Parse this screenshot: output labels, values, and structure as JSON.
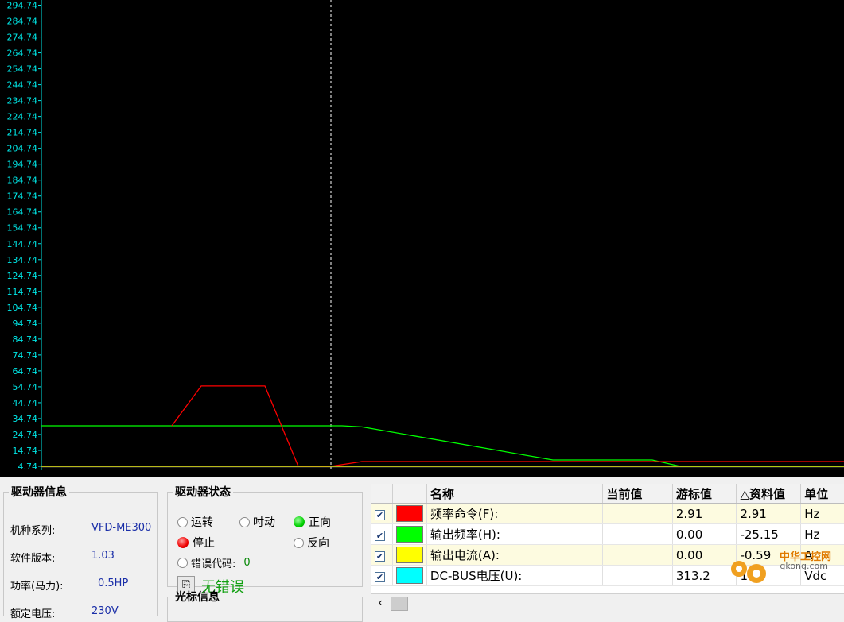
{
  "chart_data": {
    "type": "line",
    "y_ticks": [
      "4.74",
      "14.74",
      "24.74",
      "34.74",
      "44.74",
      "54.74",
      "64.74",
      "74.74",
      "84.74",
      "94.74",
      "104.74",
      "114.74",
      "124.74",
      "134.74",
      "144.74",
      "154.74",
      "164.74",
      "174.74",
      "184.74",
      "194.74",
      "204.74",
      "214.74",
      "224.74",
      "234.74",
      "244.74",
      "254.74",
      "264.74",
      "274.74",
      "284.74",
      "294.74"
    ],
    "ylim": [
      0,
      297
    ],
    "background": "#000000",
    "axis_color": "#00e5e5",
    "cursor_x": 416,
    "series": [
      {
        "color": "#ff0000",
        "x": [
          216,
          253,
          333,
          375,
          416,
          455,
          1061
        ],
        "y": [
          25.5,
          50.5,
          50.5,
          0,
          0,
          3,
          3
        ]
      },
      {
        "color": "#00ff00",
        "x": [
          52,
          430,
          455,
          695,
          820,
          855,
          1061
        ],
        "y": [
          25.5,
          25.5,
          24.8,
          4.0,
          4.0,
          0,
          0
        ]
      },
      {
        "color": "#ffff00",
        "x": [
          52,
          1061
        ],
        "y": [
          0,
          0
        ]
      }
    ]
  },
  "drive_info": {
    "title": "驱动器信息",
    "rows": [
      {
        "label": "机种系列:",
        "value": "VFD-ME300"
      },
      {
        "label": "软件版本:",
        "value": "1.03"
      },
      {
        "label": "功率(马力):",
        "value": "0.5HP"
      },
      {
        "label": "额定电压:",
        "value": "230V"
      }
    ]
  },
  "drive_status": {
    "title": "驱动器状态",
    "run": "运转",
    "jog": "吋动",
    "forward": "正向",
    "stop": "停止",
    "reverse": "反向",
    "error_code_label": "错误代码:",
    "error_code_value": "0",
    "no_error": "无错误",
    "forward_led_color": "#00d000",
    "stop_led_color": "#f00000"
  },
  "cursor_info": {
    "title": "光标信息"
  },
  "table": {
    "headers": [
      "",
      "",
      "名称",
      "当前值",
      "游标值",
      "△资料值",
      "单位"
    ],
    "rows": [
      {
        "color": "#ff0000",
        "name": "频率命令(F):",
        "current": "",
        "cursor": "2.91",
        "delta": "2.91",
        "unit": "Hz"
      },
      {
        "color": "#00ff00",
        "name": "输出频率(H):",
        "current": "",
        "cursor": "0.00",
        "delta": "-25.15",
        "unit": "Hz"
      },
      {
        "color": "#ffff00",
        "name": "输出电流(A):",
        "current": "",
        "cursor": "0.00",
        "delta": "-0.59",
        "unit": "A"
      },
      {
        "color": "#00ffff",
        "name": "DC-BUS电压(U):",
        "current": "",
        "cursor": "313.2",
        "delta": "1.9",
        "unit": "Vdc"
      }
    ]
  },
  "watermark": {
    "text": "中华工控网",
    "url": "gkong.com"
  }
}
